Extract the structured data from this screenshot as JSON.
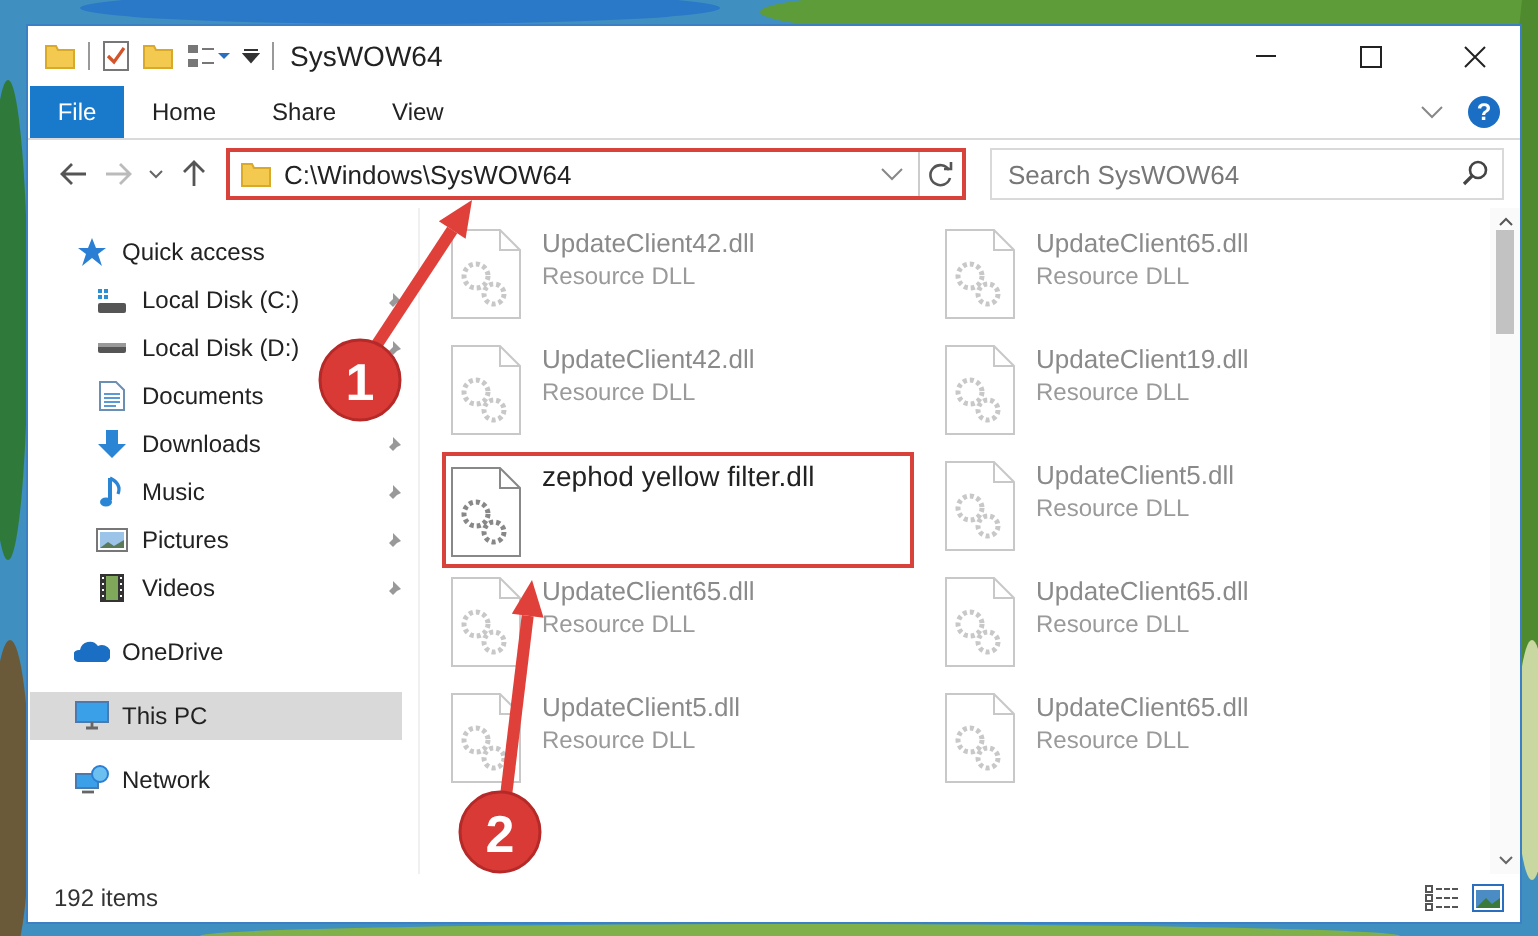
{
  "window": {
    "title": "SysWOW64"
  },
  "ribbon_tabs": [
    {
      "label": "File",
      "kind": "file"
    },
    {
      "label": "Home",
      "kind": "tab"
    },
    {
      "label": "Share",
      "kind": "tab"
    },
    {
      "label": "View",
      "kind": "tab"
    }
  ],
  "help": "?",
  "address": {
    "path": "C:\\Windows\\SysWOW64",
    "marked": true
  },
  "search": {
    "placeholder": "Search SysWOW64"
  },
  "sidebar": {
    "items": [
      {
        "label": "Quick access",
        "kind": "star",
        "selected": false,
        "children": [
          {
            "label": "Local Disk (C:)",
            "kind": "system-drive",
            "pinned": true,
            "selected": false
          },
          {
            "label": "Local Disk (D:)",
            "kind": "drive",
            "pinned": true,
            "selected": false
          },
          {
            "label": "Documents",
            "kind": "document",
            "pinned": false,
            "selected": false
          },
          {
            "label": "Downloads",
            "kind": "download",
            "pinned": true,
            "selected": false
          },
          {
            "label": "Music",
            "kind": "music",
            "pinned": true,
            "selected": false
          },
          {
            "label": "Pictures",
            "kind": "pictures",
            "pinned": true,
            "selected": false
          },
          {
            "label": "Videos",
            "kind": "videos",
            "pinned": true,
            "selected": false
          }
        ]
      },
      {
        "label": "OneDrive",
        "kind": "cloud",
        "selected": false
      },
      {
        "label": "This PC",
        "kind": "computer",
        "selected": true
      },
      {
        "label": "Network",
        "kind": "network",
        "selected": false
      }
    ]
  },
  "files": [
    {
      "name": "UpdateClient42.dll",
      "type": "Resource DLL",
      "faded": true,
      "marked": false
    },
    {
      "name": "UpdateClient65.dll",
      "type": "Resource DLL",
      "faded": true,
      "marked": false
    },
    {
      "name": "UpdateClient42.dll",
      "type": "Resource DLL",
      "faded": true,
      "marked": false
    },
    {
      "name": "UpdateClient19.dll",
      "type": "Resource DLL",
      "faded": true,
      "marked": false
    },
    {
      "name": "zephod yellow filter.dll",
      "faded": false,
      "marked": true
    },
    {
      "name": "UpdateClient5.dll",
      "type": "Resource DLL",
      "faded": true,
      "marked": false
    },
    {
      "name": "UpdateClient65.dll",
      "type": "Resource DLL",
      "faded": true,
      "marked": false
    },
    {
      "name": "UpdateClient65.dll",
      "type": "Resource DLL",
      "faded": true,
      "marked": false
    },
    {
      "name": "UpdateClient5.dll",
      "type": "Resource DLL",
      "faded": true,
      "marked": false
    },
    {
      "name": "UpdateClient65.dll",
      "type": "Resource DLL",
      "faded": true,
      "marked": false
    }
  ],
  "status_bar": {
    "count": "192 items"
  },
  "callouts": [
    {
      "number": "1"
    },
    {
      "number": "2"
    }
  ]
}
